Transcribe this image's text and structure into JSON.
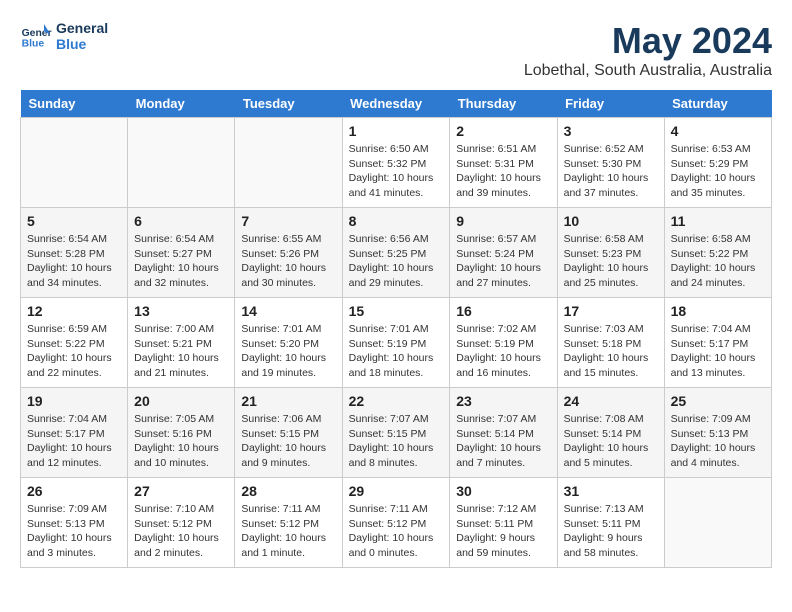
{
  "header": {
    "logo_line1": "General",
    "logo_line2": "Blue",
    "title": "May 2024",
    "subtitle": "Lobethal, South Australia, Australia"
  },
  "days_of_week": [
    "Sunday",
    "Monday",
    "Tuesday",
    "Wednesday",
    "Thursday",
    "Friday",
    "Saturday"
  ],
  "weeks": [
    {
      "days": [
        {
          "num": "",
          "info": ""
        },
        {
          "num": "",
          "info": ""
        },
        {
          "num": "",
          "info": ""
        },
        {
          "num": "1",
          "info": "Sunrise: 6:50 AM\nSunset: 5:32 PM\nDaylight: 10 hours\nand 41 minutes."
        },
        {
          "num": "2",
          "info": "Sunrise: 6:51 AM\nSunset: 5:31 PM\nDaylight: 10 hours\nand 39 minutes."
        },
        {
          "num": "3",
          "info": "Sunrise: 6:52 AM\nSunset: 5:30 PM\nDaylight: 10 hours\nand 37 minutes."
        },
        {
          "num": "4",
          "info": "Sunrise: 6:53 AM\nSunset: 5:29 PM\nDaylight: 10 hours\nand 35 minutes."
        }
      ]
    },
    {
      "days": [
        {
          "num": "5",
          "info": "Sunrise: 6:54 AM\nSunset: 5:28 PM\nDaylight: 10 hours\nand 34 minutes."
        },
        {
          "num": "6",
          "info": "Sunrise: 6:54 AM\nSunset: 5:27 PM\nDaylight: 10 hours\nand 32 minutes."
        },
        {
          "num": "7",
          "info": "Sunrise: 6:55 AM\nSunset: 5:26 PM\nDaylight: 10 hours\nand 30 minutes."
        },
        {
          "num": "8",
          "info": "Sunrise: 6:56 AM\nSunset: 5:25 PM\nDaylight: 10 hours\nand 29 minutes."
        },
        {
          "num": "9",
          "info": "Sunrise: 6:57 AM\nSunset: 5:24 PM\nDaylight: 10 hours\nand 27 minutes."
        },
        {
          "num": "10",
          "info": "Sunrise: 6:58 AM\nSunset: 5:23 PM\nDaylight: 10 hours\nand 25 minutes."
        },
        {
          "num": "11",
          "info": "Sunrise: 6:58 AM\nSunset: 5:22 PM\nDaylight: 10 hours\nand 24 minutes."
        }
      ]
    },
    {
      "days": [
        {
          "num": "12",
          "info": "Sunrise: 6:59 AM\nSunset: 5:22 PM\nDaylight: 10 hours\nand 22 minutes."
        },
        {
          "num": "13",
          "info": "Sunrise: 7:00 AM\nSunset: 5:21 PM\nDaylight: 10 hours\nand 21 minutes."
        },
        {
          "num": "14",
          "info": "Sunrise: 7:01 AM\nSunset: 5:20 PM\nDaylight: 10 hours\nand 19 minutes."
        },
        {
          "num": "15",
          "info": "Sunrise: 7:01 AM\nSunset: 5:19 PM\nDaylight: 10 hours\nand 18 minutes."
        },
        {
          "num": "16",
          "info": "Sunrise: 7:02 AM\nSunset: 5:19 PM\nDaylight: 10 hours\nand 16 minutes."
        },
        {
          "num": "17",
          "info": "Sunrise: 7:03 AM\nSunset: 5:18 PM\nDaylight: 10 hours\nand 15 minutes."
        },
        {
          "num": "18",
          "info": "Sunrise: 7:04 AM\nSunset: 5:17 PM\nDaylight: 10 hours\nand 13 minutes."
        }
      ]
    },
    {
      "days": [
        {
          "num": "19",
          "info": "Sunrise: 7:04 AM\nSunset: 5:17 PM\nDaylight: 10 hours\nand 12 minutes."
        },
        {
          "num": "20",
          "info": "Sunrise: 7:05 AM\nSunset: 5:16 PM\nDaylight: 10 hours\nand 10 minutes."
        },
        {
          "num": "21",
          "info": "Sunrise: 7:06 AM\nSunset: 5:15 PM\nDaylight: 10 hours\nand 9 minutes."
        },
        {
          "num": "22",
          "info": "Sunrise: 7:07 AM\nSunset: 5:15 PM\nDaylight: 10 hours\nand 8 minutes."
        },
        {
          "num": "23",
          "info": "Sunrise: 7:07 AM\nSunset: 5:14 PM\nDaylight: 10 hours\nand 7 minutes."
        },
        {
          "num": "24",
          "info": "Sunrise: 7:08 AM\nSunset: 5:14 PM\nDaylight: 10 hours\nand 5 minutes."
        },
        {
          "num": "25",
          "info": "Sunrise: 7:09 AM\nSunset: 5:13 PM\nDaylight: 10 hours\nand 4 minutes."
        }
      ]
    },
    {
      "days": [
        {
          "num": "26",
          "info": "Sunrise: 7:09 AM\nSunset: 5:13 PM\nDaylight: 10 hours\nand 3 minutes."
        },
        {
          "num": "27",
          "info": "Sunrise: 7:10 AM\nSunset: 5:12 PM\nDaylight: 10 hours\nand 2 minutes."
        },
        {
          "num": "28",
          "info": "Sunrise: 7:11 AM\nSunset: 5:12 PM\nDaylight: 10 hours\nand 1 minute."
        },
        {
          "num": "29",
          "info": "Sunrise: 7:11 AM\nSunset: 5:12 PM\nDaylight: 10 hours\nand 0 minutes."
        },
        {
          "num": "30",
          "info": "Sunrise: 7:12 AM\nSunset: 5:11 PM\nDaylight: 9 hours\nand 59 minutes."
        },
        {
          "num": "31",
          "info": "Sunrise: 7:13 AM\nSunset: 5:11 PM\nDaylight: 9 hours\nand 58 minutes."
        },
        {
          "num": "",
          "info": ""
        }
      ]
    }
  ]
}
